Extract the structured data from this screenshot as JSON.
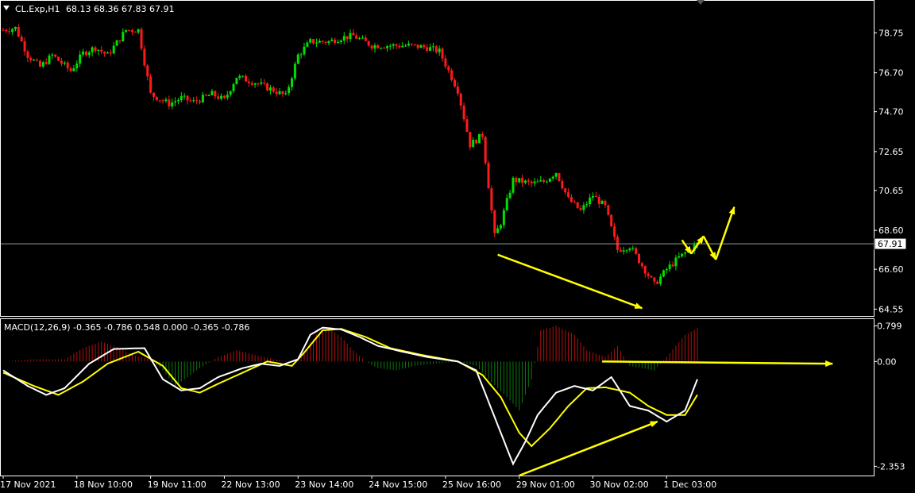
{
  "header": {
    "symbol": "CL.Exp,H1",
    "ohlc": "68.13 68.36 67.83 67.91"
  },
  "macd_header": {
    "label": "MACD(12,26,9) -0.365 -0.786 0.548 0.000 -0.365 -0.786"
  },
  "colors": {
    "background": "#000000",
    "bull_candle": "#00e000",
    "bear_candle": "#ff1a1a",
    "macd_main": "#ffffff",
    "macd_signal": "#ffff00",
    "hist_positive": "#b01010",
    "hist_negative": "#0a7a0a",
    "annotation": "#ffff00",
    "grid": "#888888"
  },
  "chart_data": [
    {
      "type": "candlestick",
      "name": "price",
      "ylim": [
        64.2,
        80.4
      ],
      "y_ticks": [
        "78.75",
        "76.70",
        "74.70",
        "72.65",
        "70.65",
        "68.60",
        "66.60",
        "64.55"
      ],
      "current_price": "67.91",
      "anchors": [
        [
          0,
          78.9
        ],
        [
          4,
          79.0
        ],
        [
          8,
          77.6
        ],
        [
          12,
          77.0
        ],
        [
          16,
          77.6
        ],
        [
          22,
          76.8
        ],
        [
          26,
          77.7
        ],
        [
          30,
          78.0
        ],
        [
          34,
          77.6
        ],
        [
          40,
          78.9
        ],
        [
          44,
          78.9
        ],
        [
          48,
          75.6
        ],
        [
          54,
          75.1
        ],
        [
          58,
          75.4
        ],
        [
          62,
          75.2
        ],
        [
          68,
          75.6
        ],
        [
          72,
          75.3
        ],
        [
          76,
          76.5
        ],
        [
          82,
          76.2
        ],
        [
          88,
          75.8
        ],
        [
          92,
          75.5
        ],
        [
          96,
          77.6
        ],
        [
          100,
          78.3
        ],
        [
          106,
          78.3
        ],
        [
          110,
          78.5
        ],
        [
          114,
          78.6
        ],
        [
          120,
          78.1
        ],
        [
          126,
          78.1
        ],
        [
          132,
          78.1
        ],
        [
          138,
          78.0
        ],
        [
          142,
          77.8
        ],
        [
          148,
          75.8
        ],
        [
          152,
          73.0
        ],
        [
          156,
          73.5
        ],
        [
          160,
          68.3
        ],
        [
          162,
          69.0
        ],
        [
          166,
          71.2
        ],
        [
          172,
          71.0
        ],
        [
          176,
          71.1
        ],
        [
          180,
          71.6
        ],
        [
          184,
          70.2
        ],
        [
          188,
          69.6
        ],
        [
          192,
          70.4
        ],
        [
          196,
          69.8
        ],
        [
          200,
          67.6
        ],
        [
          204,
          67.8
        ],
        [
          208,
          66.8
        ],
        [
          212,
          65.8
        ],
        [
          216,
          66.6
        ],
        [
          220,
          67.2
        ],
        [
          226,
          67.9
        ]
      ]
    },
    {
      "type": "line",
      "name": "MACD(12,26,9)",
      "ylim": [
        -2.56,
        0.95
      ],
      "y_ticks": [
        "0.799",
        "0.00",
        "-2.353"
      ],
      "series": [
        {
          "role": "main",
          "points": [
            [
              0,
              -0.2
            ],
            [
              8,
              -0.55
            ],
            [
              14,
              -0.75
            ],
            [
              20,
              -0.6
            ],
            [
              28,
              -0.05
            ],
            [
              36,
              0.28
            ],
            [
              46,
              0.3
            ],
            [
              52,
              -0.4
            ],
            [
              58,
              -0.65
            ],
            [
              64,
              -0.6
            ],
            [
              70,
              -0.35
            ],
            [
              78,
              -0.15
            ],
            [
              84,
              -0.05
            ],
            [
              90,
              -0.1
            ],
            [
              96,
              0.05
            ],
            [
              100,
              0.6
            ],
            [
              104,
              0.76
            ],
            [
              110,
              0.72
            ],
            [
              116,
              0.55
            ],
            [
              122,
              0.35
            ],
            [
              130,
              0.22
            ],
            [
              138,
              0.1
            ],
            [
              148,
              0.0
            ],
            [
              154,
              -0.2
            ],
            [
              158,
              -0.9
            ],
            [
              162,
              -1.6
            ],
            [
              166,
              -2.3
            ],
            [
              170,
              -1.8
            ],
            [
              174,
              -1.2
            ],
            [
              180,
              -0.7
            ],
            [
              186,
              -0.55
            ],
            [
              192,
              -0.65
            ],
            [
              198,
              -0.35
            ],
            [
              204,
              -1.0
            ],
            [
              210,
              -1.1
            ],
            [
              216,
              -1.35
            ],
            [
              222,
              -1.1
            ],
            [
              226,
              -0.4
            ]
          ]
        },
        {
          "role": "signal",
          "points": [
            [
              0,
              -0.25
            ],
            [
              10,
              -0.55
            ],
            [
              18,
              -0.75
            ],
            [
              26,
              -0.45
            ],
            [
              34,
              -0.05
            ],
            [
              44,
              0.22
            ],
            [
              52,
              -0.1
            ],
            [
              58,
              -0.6
            ],
            [
              64,
              -0.7
            ],
            [
              70,
              -0.5
            ],
            [
              78,
              -0.25
            ],
            [
              86,
              0.0
            ],
            [
              94,
              -0.1
            ],
            [
              98,
              0.2
            ],
            [
              104,
              0.7
            ],
            [
              110,
              0.73
            ],
            [
              118,
              0.55
            ],
            [
              126,
              0.3
            ],
            [
              136,
              0.15
            ],
            [
              148,
              0.0
            ],
            [
              156,
              -0.3
            ],
            [
              162,
              -0.8
            ],
            [
              168,
              -1.6
            ],
            [
              172,
              -1.9
            ],
            [
              178,
              -1.5
            ],
            [
              184,
              -1.0
            ],
            [
              190,
              -0.6
            ],
            [
              196,
              -0.58
            ],
            [
              204,
              -0.7
            ],
            [
              210,
              -1.0
            ],
            [
              216,
              -1.2
            ],
            [
              222,
              -1.2
            ],
            [
              226,
              -0.75
            ]
          ]
        }
      ],
      "histogram": [
        [
          0,
          0.0
        ],
        [
          10,
          0.05
        ],
        [
          20,
          0.05
        ],
        [
          26,
          0.3
        ],
        [
          32,
          0.45
        ],
        [
          38,
          0.3
        ],
        [
          42,
          0.15
        ],
        [
          48,
          0.05
        ],
        [
          52,
          -0.2
        ],
        [
          56,
          -0.55
        ],
        [
          60,
          -0.35
        ],
        [
          64,
          -0.15
        ],
        [
          70,
          0.1
        ],
        [
          76,
          0.25
        ],
        [
          82,
          0.15
        ],
        [
          88,
          0.05
        ],
        [
          94,
          0.0
        ],
        [
          98,
          0.2
        ],
        [
          102,
          0.6
        ],
        [
          106,
          0.75
        ],
        [
          110,
          0.55
        ],
        [
          114,
          0.25
        ],
        [
          118,
          0.0
        ],
        [
          122,
          -0.15
        ],
        [
          128,
          -0.2
        ],
        [
          134,
          -0.1
        ],
        [
          140,
          -0.05
        ],
        [
          148,
          0.0
        ],
        [
          154,
          -0.1
        ],
        [
          158,
          -0.4
        ],
        [
          164,
          -0.8
        ],
        [
          168,
          -1.1
        ],
        [
          172,
          -0.4
        ],
        [
          175,
          0.7
        ],
        [
          180,
          0.8
        ],
        [
          186,
          0.6
        ],
        [
          190,
          0.25
        ],
        [
          196,
          0.1
        ],
        [
          200,
          0.35
        ],
        [
          204,
          -0.1
        ],
        [
          212,
          -0.2
        ],
        [
          216,
          0.1
        ],
        [
          222,
          0.6
        ],
        [
          226,
          0.75
        ]
      ]
    }
  ],
  "x_axis": {
    "total_bars": 227,
    "labels": [
      {
        "index": 0,
        "text": "17 Nov 2021"
      },
      {
        "index": 24,
        "text": "18 Nov 10:00"
      },
      {
        "index": 48,
        "text": "19 Nov 11:00"
      },
      {
        "index": 72,
        "text": "22 Nov 13:00"
      },
      {
        "index": 96,
        "text": "23 Nov 14:00"
      },
      {
        "index": 120,
        "text": "24 Nov 15:00"
      },
      {
        "index": 144,
        "text": "25 Nov 16:00"
      },
      {
        "index": 168,
        "text": "29 Nov 01:00"
      },
      {
        "index": 192,
        "text": "30 Nov 02:00"
      },
      {
        "index": 216,
        "text": "1 Dec 03:00"
      }
    ]
  },
  "annotations": {
    "price_divergence": {
      "from": [
        161,
        67.35
      ],
      "to": [
        208,
        64.6
      ]
    },
    "macd_divergence": {
      "from": [
        168,
        -2.56
      ],
      "to": [
        213,
        -1.35
      ]
    },
    "zero_arrow": {
      "from": [
        195,
        0.0
      ],
      "to": [
        270,
        -0.05
      ]
    },
    "forecast_path": [
      [
        221,
        68.1
      ],
      [
        224,
        67.4
      ],
      [
        228,
        68.3
      ],
      [
        232,
        67.1
      ],
      [
        238,
        69.8
      ]
    ]
  }
}
